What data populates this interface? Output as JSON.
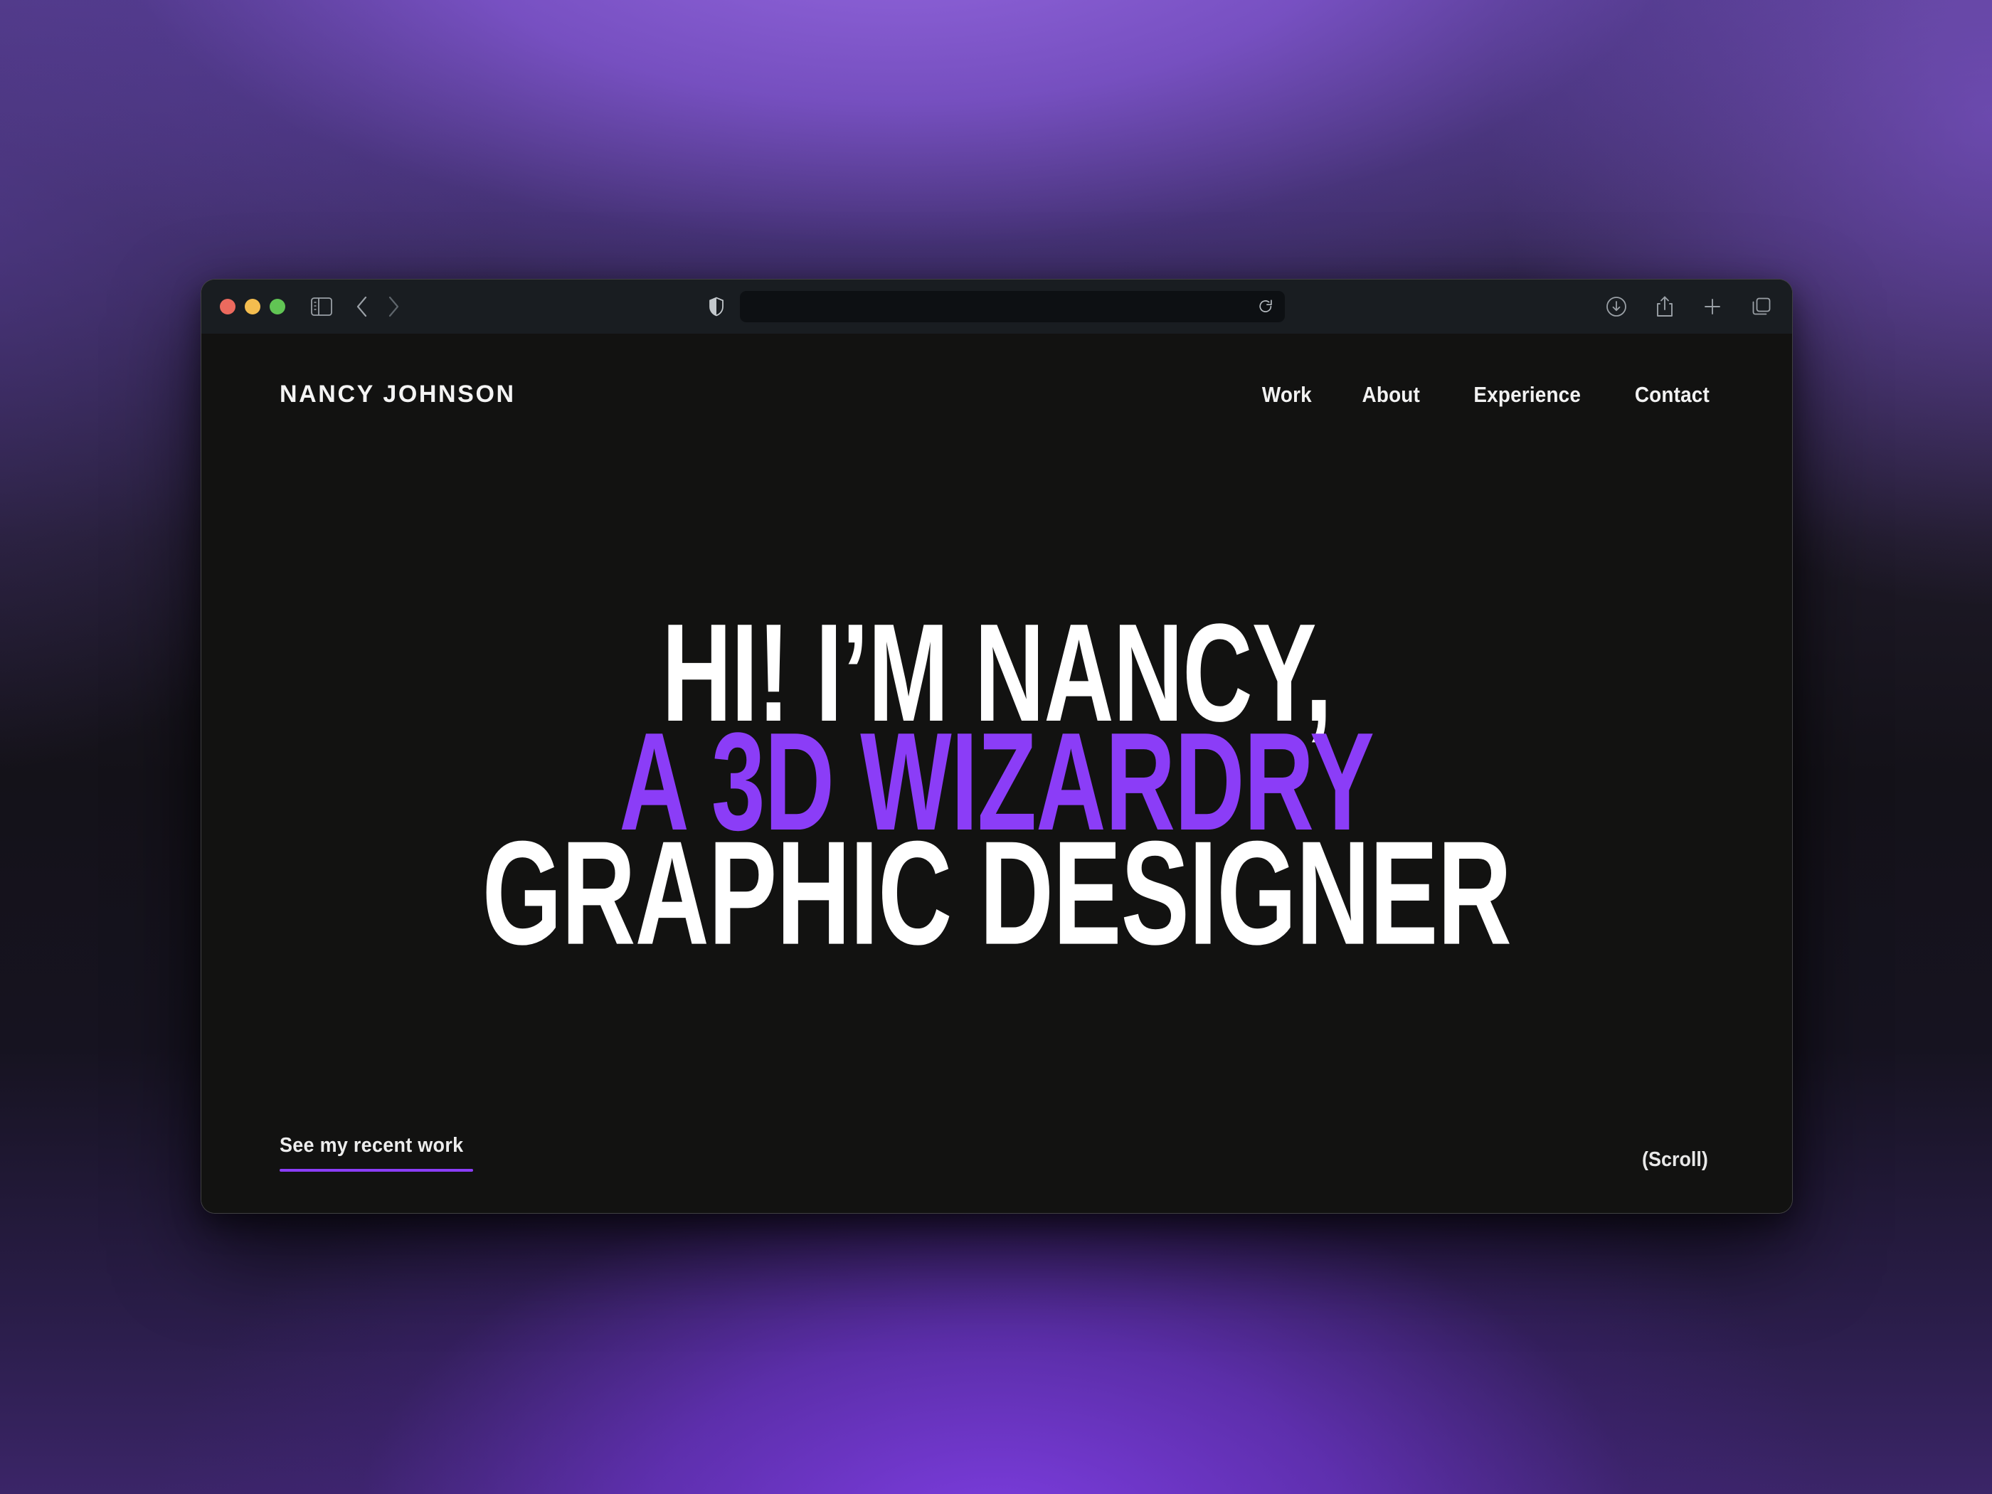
{
  "browser": {
    "window_controls": [
      {
        "name": "close",
        "color": "#ec6a5e"
      },
      {
        "name": "minimize",
        "color": "#f4bd4f"
      },
      {
        "name": "maximize",
        "color": "#61c554"
      }
    ],
    "sidebar_toggle_icon": "sidebar-icon",
    "back_icon": "chevron-left-icon",
    "forward_icon": "chevron-right-icon",
    "shield_icon": "shield-icon",
    "reload_icon": "reload-icon",
    "address": {
      "value": "",
      "placeholder": ""
    },
    "right_tools": [
      {
        "label": "Downloads",
        "icon": "download-circle-icon"
      },
      {
        "label": "Share",
        "icon": "share-icon"
      },
      {
        "label": "New Tab",
        "icon": "plus-icon"
      },
      {
        "label": "Tab Overview",
        "icon": "tab-overview-icon"
      }
    ],
    "toolbar_bg": "#191d21",
    "page_bg": "#121211"
  },
  "site": {
    "logo": "NANCY JOHNSON",
    "nav": [
      {
        "label": "Work"
      },
      {
        "label": "About"
      },
      {
        "label": "Experience"
      },
      {
        "label": "Contact"
      }
    ],
    "hero": {
      "line1": "HI! I’M NANCY,",
      "line2": "A 3D WIZARDRY",
      "line3": "GRAPHIC DESIGNER"
    },
    "cta": {
      "label": "See my recent work"
    },
    "scroll_hint": "(Scroll)",
    "colors": {
      "accent_purple": "#8b3df7",
      "text_white": "#ffffff",
      "page_background": "#121211"
    }
  }
}
